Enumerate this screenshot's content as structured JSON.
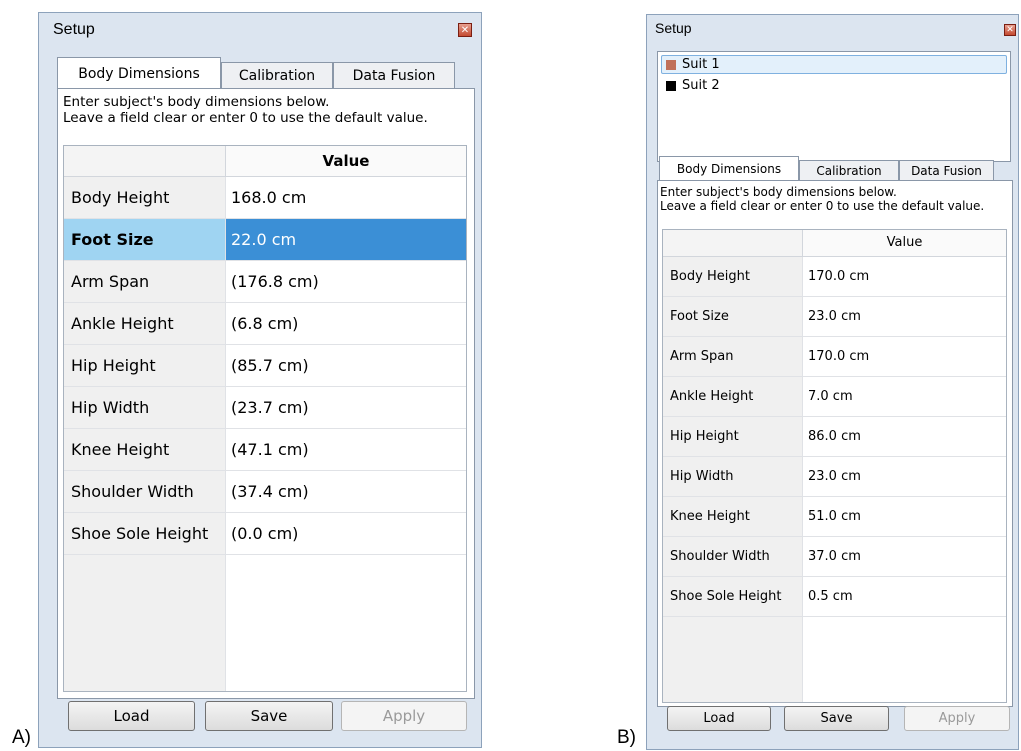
{
  "figure_labels": {
    "a": "A)",
    "b": "B)"
  },
  "panel_a": {
    "title": "Setup",
    "tabs": [
      {
        "label": "Body Dimensions",
        "active": true
      },
      {
        "label": "Calibration",
        "active": false
      },
      {
        "label": "Data Fusion",
        "active": false
      }
    ],
    "description_line1": "Enter subject's body dimensions below.",
    "description_line2": "Leave a field clear or enter 0 to use the default value.",
    "grid_header": {
      "label": "",
      "value": "Value"
    },
    "rows": [
      {
        "label": "Body Height",
        "value": "168.0 cm",
        "selected": false
      },
      {
        "label": "Foot Size",
        "value": "22.0 cm",
        "selected": true
      },
      {
        "label": "Arm Span",
        "value": "(176.8 cm)",
        "selected": false
      },
      {
        "label": "Ankle Height",
        "value": "(6.8 cm)",
        "selected": false
      },
      {
        "label": "Hip Height",
        "value": "(85.7 cm)",
        "selected": false
      },
      {
        "label": "Hip Width",
        "value": "(23.7 cm)",
        "selected": false
      },
      {
        "label": "Knee Height",
        "value": "(47.1 cm)",
        "selected": false
      },
      {
        "label": "Shoulder Width",
        "value": "(37.4 cm)",
        "selected": false
      },
      {
        "label": "Shoe Sole Height",
        "value": "(0.0 cm)",
        "selected": false
      }
    ],
    "buttons": {
      "load": "Load",
      "save": "Save",
      "apply": "Apply"
    }
  },
  "panel_b": {
    "title": "Setup",
    "suits": [
      {
        "label": "Suit 1",
        "color": "#c0705a",
        "selected": true
      },
      {
        "label": "Suit 2",
        "color": "#000000",
        "selected": false
      }
    ],
    "tabs": [
      {
        "label": "Body Dimensions",
        "active": true
      },
      {
        "label": "Calibration",
        "active": false
      },
      {
        "label": "Data Fusion",
        "active": false
      }
    ],
    "description_line1": "Enter subject's body dimensions below.",
    "description_line2": "Leave a field clear or enter 0 to use the default value.",
    "grid_header": {
      "label": "",
      "value": "Value"
    },
    "rows": [
      {
        "label": "Body Height",
        "value": "170.0 cm"
      },
      {
        "label": "Foot Size",
        "value": "23.0 cm"
      },
      {
        "label": "Arm Span",
        "value": "170.0 cm"
      },
      {
        "label": "Ankle Height",
        "value": "7.0 cm"
      },
      {
        "label": "Hip Height",
        "value": "86.0 cm"
      },
      {
        "label": "Hip Width",
        "value": "23.0 cm"
      },
      {
        "label": "Knee Height",
        "value": "51.0 cm"
      },
      {
        "label": "Shoulder Width",
        "value": "37.0 cm"
      },
      {
        "label": "Shoe Sole Height",
        "value": "0.5 cm"
      }
    ],
    "buttons": {
      "load": "Load",
      "save": "Save",
      "apply": "Apply"
    }
  },
  "colors": {
    "selection_blue": "#3b8fd6",
    "selection_label": "#9fd4f2",
    "panel_bg": "#dce5f0",
    "close_red": "#c44a31"
  },
  "icons": {
    "close": "close-icon"
  }
}
